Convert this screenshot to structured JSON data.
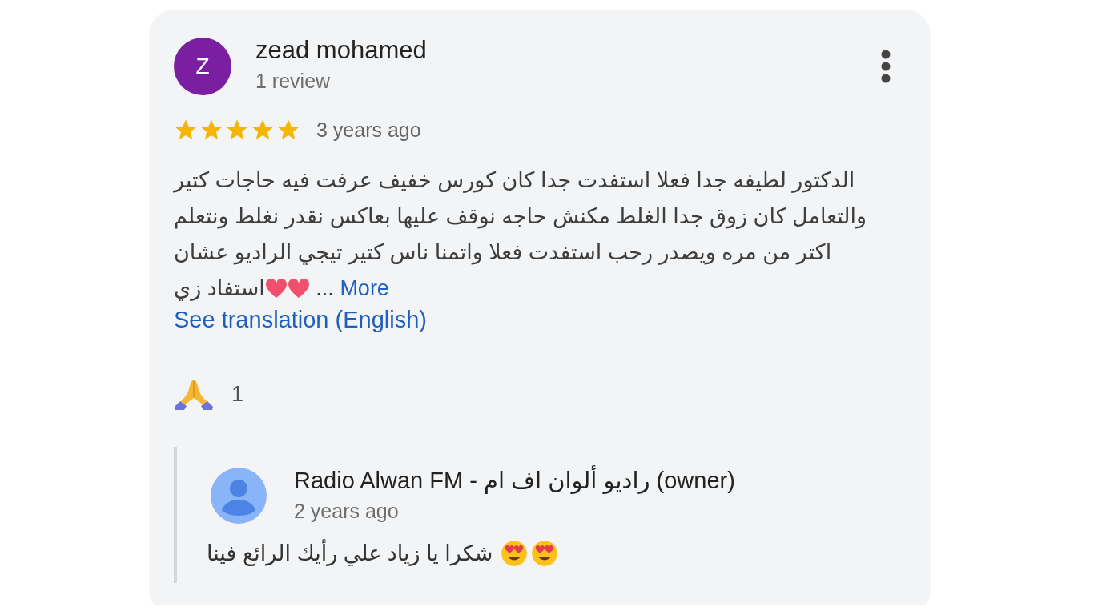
{
  "review": {
    "avatar_letter": "Z",
    "author": "zead mohamed",
    "author_meta": "1 review",
    "stars": 5,
    "time": "3 years ago",
    "text": "الدكتور لطيفه جدا فعلا استفدت جدا كان كورس خفيف عرفت فيه حاجات كتير والتعامل كان زوق جدا الغلط مكنش حاجه نوقف عليها بعاكس نقدر نغلط ونتعلم اكتر من مره ويصدر رحب استفدت فعلا واتمنا ناس كتير تيجي الراديو عشان استفاد زي",
    "ellipsis": "...",
    "more": "More",
    "translate": "See translation (English)",
    "reaction_count": "1"
  },
  "owner_reply": {
    "author": "Radio Alwan FM - راديو ألوان اف ام (owner)",
    "time": "2 years ago",
    "text": "شكرا يا زياد علي رأيك الرائع فينا"
  }
}
